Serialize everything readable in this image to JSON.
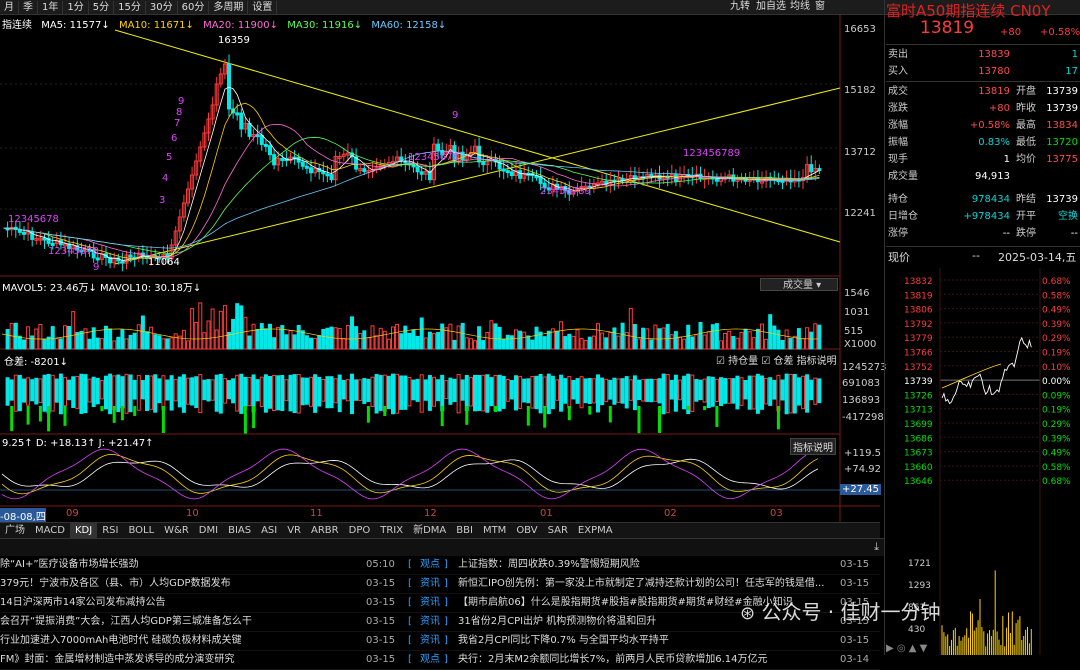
{
  "toolbar": {
    "periods": [
      "月",
      "季",
      "1年",
      "1分",
      "5分",
      "15分",
      "30分",
      "60分",
      "多周期",
      "设置"
    ],
    "right": [
      "九转",
      "加自选",
      "均线",
      "窗"
    ]
  },
  "chart_title": "指连续",
  "ma": {
    "ma5": "MA5: 11577↓",
    "ma10": "MA10: 11671↓",
    "ma20": "MA20: 11900↓",
    "ma30": "MA30: 11916↓",
    "ma60": "MA60: 12158↓"
  },
  "price_axis": [
    "16653",
    "15182",
    "13712",
    "12241"
  ],
  "high_label": "16359",
  "low_label": "11064",
  "td_up": [
    "1",
    "2",
    "3",
    "4",
    "5",
    "6",
    "7",
    "8",
    "9"
  ],
  "td_marks": {
    "a": "9",
    "b": "9",
    "c": "12345678",
    "d": "9",
    "e": "23456789",
    "f": "123456789",
    "g": "3456789",
    "h": "12345678",
    "i": "9"
  },
  "vol": {
    "legend": "MAVOL5: 23.46万↓  MAVOL10: 30.18万↓",
    "axis": [
      "1546",
      "1031",
      "515",
      "X1000"
    ],
    "selector": "成交量"
  },
  "oi": {
    "legend": "仓差: -8201↓",
    "axis": [
      "1245273",
      "691083",
      "136893",
      "-417298"
    ],
    "opts": [
      "持仓量",
      "仓差",
      "指标说明"
    ]
  },
  "kdj": {
    "legend": "9.25↑ D: +18.13↑ J: +21.47↑",
    "axis": [
      "+119.5",
      "+74.92",
      "+27.45"
    ],
    "explain": "指标说明"
  },
  "months": [
    "-08-08,四",
    "09",
    "10",
    "11",
    "12",
    "01",
    "02",
    "03"
  ],
  "tabs": [
    "广场",
    "MACD",
    "KDJ",
    "RSI",
    "BOLL",
    "W&R",
    "DMI",
    "BIAS",
    "ASI",
    "VR",
    "ARBR",
    "DPO",
    "TRIX",
    "新DMA",
    "BBI",
    "MTM",
    "OBV",
    "SAR",
    "EXPMA"
  ],
  "active_tab": "KDJ",
  "news_left": [
    {
      "t": "除“AI+”医疗设备市场增长强劲",
      "d": "05:10"
    },
    {
      "t": "379元！宁波市及各区（县、市）人均GDP数据发布",
      "d": "03-15"
    },
    {
      "t": "14日沪深两市14家公司发布减持公告",
      "d": "03-15"
    },
    {
      "t": "会召开“提振消费”大会，江西人均GDP第三城准备怎么干",
      "d": "03-15"
    },
    {
      "t": "行业加速进入7000mAh电池时代 硅碳负极材料成关键",
      "d": "03-15"
    },
    {
      "t": "FM》封面：金属增材制造中蒸发诱导的成分演变研究",
      "d": "03-15"
    }
  ],
  "news_right": [
    {
      "c": "观点",
      "t": "上证指数：周四收跌0.39%警惕短期风险",
      "d": "03-15"
    },
    {
      "c": "资讯",
      "t": "新恒汇IPO创先例：第一家没上市就制定了减持还款计划的公司！任志军的钱是借...",
      "d": "03-15"
    },
    {
      "c": "资讯",
      "t": "【期市启航06】什么是股指期货#股指#股指期货#期货#财经#金融小知识",
      "d": "03-15"
    },
    {
      "c": "资讯",
      "t": "31省份2月CPI出炉 机构预测物价将温和回升",
      "d": "03-15"
    },
    {
      "c": "资讯",
      "t": "我省2月CPI同比下降0.7% 与全国平均水平持平",
      "d": "03-15"
    },
    {
      "c": "观点",
      "t": "央行：2月末M2余额同比增长7%，前两月人民币贷款增加6.14万亿元",
      "d": "03-14"
    }
  ],
  "quote": {
    "name": "富时A50期指连续 CN0Y",
    "price": "13819",
    "chg": "+80",
    "pct": "+0.58%",
    "ask_label": "卖出",
    "ask": "13839",
    "ask_vol": "1",
    "bid_label": "买入",
    "bid": "13780",
    "bid_vol": "17",
    "rows": [
      {
        "l": "成交",
        "v": "13819",
        "l2": "开盘",
        "v2": "13739",
        "c1": "red",
        "c2": "white"
      },
      {
        "l": "涨跌",
        "v": "+80",
        "l2": "昨收",
        "v2": "13739",
        "c1": "red",
        "c2": "white"
      },
      {
        "l": "涨幅",
        "v": "+0.58%",
        "l2": "最高",
        "v2": "13834",
        "c1": "red",
        "c2": "red"
      },
      {
        "l": "振幅",
        "v": "0.83%",
        "l2": "最低",
        "v2": "13720",
        "c1": "cyan",
        "c2": "green"
      },
      {
        "l": "现手",
        "v": "1",
        "l2": "均价",
        "v2": "13775",
        "c1": "white",
        "c2": "red"
      },
      {
        "l": "成交量",
        "v": "94,913",
        "l2": "",
        "v2": "",
        "c1": "white",
        "c2": "white"
      },
      {
        "l": "持仓",
        "v": "978434",
        "l2": "昨结",
        "v2": "13739",
        "c1": "cyan",
        "c2": "white"
      },
      {
        "l": "日增仓",
        "v": "+978434",
        "l2": "开平",
        "v2": "空换",
        "c1": "cyan",
        "c2": "cyan"
      },
      {
        "l": "涨停",
        "v": "--",
        "l2": "跌停",
        "v2": "--",
        "c1": "white",
        "c2": "white"
      }
    ],
    "intraday_label": "现价",
    "intraday_dash": "--",
    "date": "2025-03-14,五",
    "mini_price": [
      "13832",
      "13819",
      "13806",
      "13792",
      "13779",
      "13766",
      "13752",
      "13739",
      "13726",
      "13713",
      "13699",
      "13686",
      "13673",
      "13660",
      "13646"
    ],
    "mini_pct": [
      "0.68%",
      "0.58%",
      "0.49%",
      "0.39%",
      "0.29%",
      "0.19%",
      "0.10%",
      "0.00%",
      "0.09%",
      "0.19%",
      "0.29%",
      "0.39%",
      "0.49%",
      "0.58%",
      "0.68%"
    ],
    "mini_vol": [
      "1721",
      "1293",
      "861",
      "430"
    ]
  },
  "watermark": "公众号 · 佳财一分钟",
  "bottom_icons": "▶ ◎ ▲ ▼",
  "colors": {
    "up": "#ff3b3b",
    "down": "#00e8e8",
    "bg": "#000000",
    "trend": "#f0f000"
  }
}
